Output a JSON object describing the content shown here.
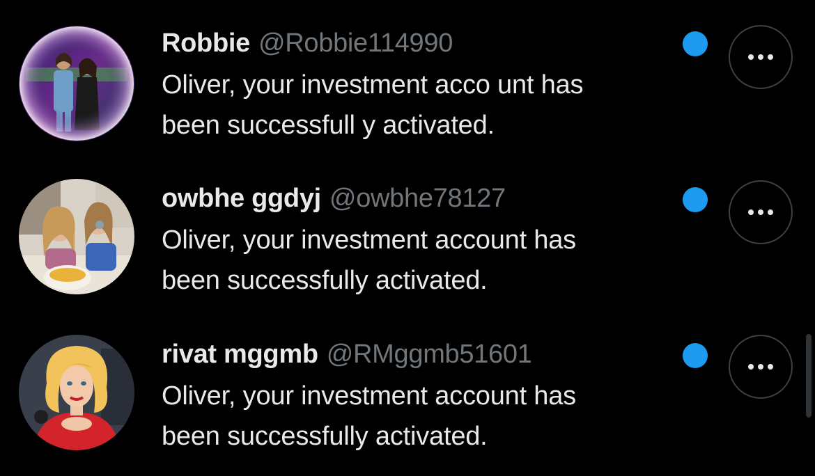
{
  "colors": {
    "background": "#000000",
    "name_text": "#e7e9ea",
    "handle_text": "#71767b",
    "unread_dot": "#1d9bf0",
    "button_border": "#3e4144"
  },
  "icons": {
    "more": "more-horizontal-icon",
    "unread": "unread-dot-icon"
  },
  "messages": [
    {
      "name": "Robbie",
      "handle": "@Robbie114990",
      "text_line1": "Oliver, your investment acco unt has",
      "text_line2": "been successfull y activated.",
      "avatar": "photo of two people at an event"
    },
    {
      "name": "owbhe ggdyj",
      "handle": "@owbhe78127",
      "text_line1": "Oliver, your investment account has",
      "text_line2": "been successfully activated.",
      "avatar": "photo of two girls with a bowl of food"
    },
    {
      "name": "rivat mggmb",
      "handle": "@RMggmb51601",
      "text_line1": "Oliver, your investment account has",
      "text_line2": "been successfully activated.",
      "avatar": "cartoon woman with blonde curly hair in red dress"
    }
  ]
}
